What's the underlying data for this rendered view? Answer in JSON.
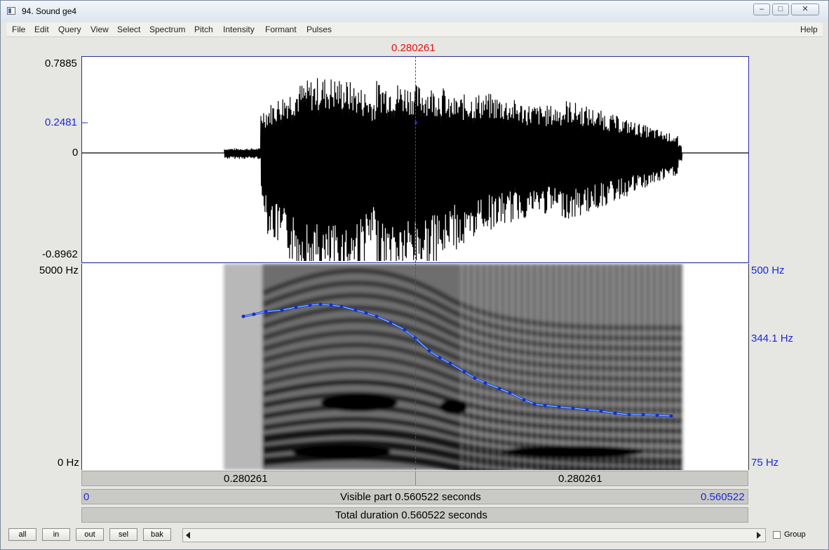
{
  "window": {
    "title": "94. Sound ge4",
    "minimize_icon": "minimize-icon",
    "maximize_icon": "maximize-icon",
    "close_icon": "close-icon"
  },
  "menu": {
    "items": [
      "File",
      "Edit",
      "Query",
      "View",
      "Select",
      "Spectrum",
      "Pitch",
      "Intensity",
      "Formant",
      "Pulses"
    ],
    "help": "Help"
  },
  "cursor": {
    "time": "0.280261"
  },
  "waveform": {
    "max_label": "0.7885",
    "cursor_value_label": "0.2481",
    "zero_label": "0",
    "min_label": "-0.8962"
  },
  "spectrogram": {
    "top_freq_label": "5000 Hz",
    "bottom_freq_label": "0 Hz",
    "pitch_top_label": "500 Hz",
    "pitch_mid_label": "344.1 Hz",
    "pitch_bottom_label": "75 Hz"
  },
  "bars": {
    "left_segment": "0.280261",
    "right_segment": "0.280261",
    "visible_start": "0",
    "visible_text": "Visible part 0.560522 seconds",
    "visible_end": "0.560522",
    "total_text": "Total duration 0.560522 seconds"
  },
  "buttons": {
    "all": "all",
    "in": "in",
    "out": "out",
    "sel": "sel",
    "bak": "bak"
  },
  "group": {
    "label": "Group",
    "checked": false
  },
  "colors": {
    "pitch": "#1f3fe0",
    "cursor": "#cc2222",
    "axis_label_blue": "#1b29d8"
  }
}
